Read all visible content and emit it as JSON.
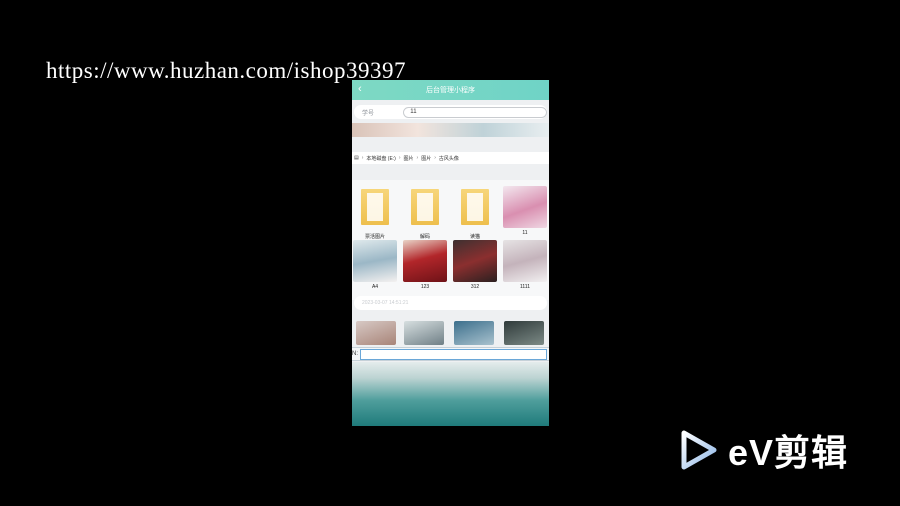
{
  "watermark": {
    "url": "https://www.huzhan.com/ishop39397"
  },
  "app": {
    "title": "后台管理小程序",
    "form": {
      "label": "学号",
      "value": "11"
    }
  },
  "breadcrumb": [
    "本地磁盘 (E:)",
    "图片",
    "图片",
    "古风头像"
  ],
  "files": [
    {
      "name": "票活图片",
      "kind": "folder"
    },
    {
      "name": "解码",
      "kind": "folder"
    },
    {
      "name": "读猫",
      "kind": "folder"
    },
    {
      "name": "11",
      "kind": "image"
    },
    {
      "name": "A4",
      "kind": "image"
    },
    {
      "name": "123",
      "kind": "image"
    },
    {
      "name": "312",
      "kind": "image"
    },
    {
      "name": "1111",
      "kind": "image"
    }
  ],
  "lower_row": {
    "date": "2023-03-07 14:51:21"
  },
  "filename_prompt": {
    "label": "N:"
  },
  "editor_logo": {
    "text": "eV剪辑",
    "icon": "play-icon"
  }
}
